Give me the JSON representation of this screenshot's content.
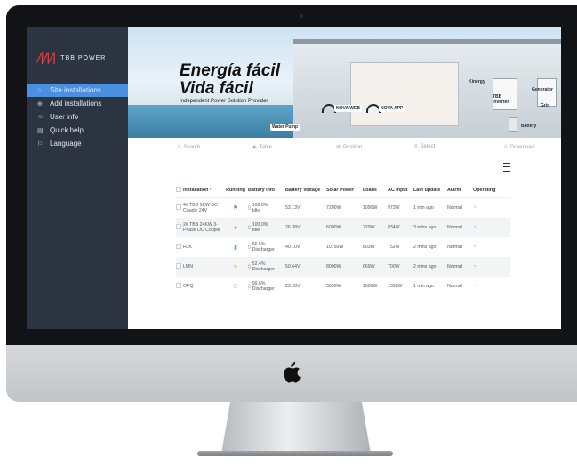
{
  "sidebar": {
    "logo_mark": "/|/|/|",
    "logo_text": "TBB POWER",
    "items": [
      {
        "label": "Site installations",
        "icon": "location-icon",
        "glyph": "⌂"
      },
      {
        "label": "Add installations",
        "icon": "plus-circle-icon",
        "glyph": "⊕"
      },
      {
        "label": "User info",
        "icon": "user-icon",
        "glyph": "☺"
      },
      {
        "label": "Quick help",
        "icon": "help-doc-icon",
        "glyph": "▤"
      },
      {
        "label": "Language",
        "icon": "flag-icon",
        "glyph": "⚐"
      }
    ]
  },
  "banner": {
    "title_line1": "Energía fácil",
    "title_line2": "Vida fácil",
    "subtitle": "Independent Power Solution Provider",
    "labels": {
      "water_pump": "Water Pump",
      "nova_web": "NOVA WEB",
      "nova_app": "NOVA APP",
      "kinergy": "Kinergy",
      "tbb_inverter": "TBB Inverter",
      "generator": "Generator",
      "grid": "Grid",
      "battery": "Battery"
    }
  },
  "toolbar": {
    "search": "Search",
    "table": "Table",
    "position": "Position",
    "select": "Select",
    "download": "Download"
  },
  "table": {
    "headers": [
      "Installation ^",
      "Running",
      "Battery Info",
      "Battery Voltage",
      "Solar Power",
      "Loads",
      "AC Input",
      "Last update",
      "Alarm",
      "Operating"
    ],
    "rows": [
      {
        "installation": "4# TBB 5KW DC Couple 24V",
        "running_icon": "tower-icon",
        "running_glyph": "⚑",
        "running_color": "#6b8fd6",
        "battery_pct": "100.0%",
        "battery_state": "Idle",
        "voltage": "52.13V",
        "solar": "7200W",
        "loads": "1090W",
        "ac_input": "973W",
        "last_update": "1 min ago",
        "alarm": "Normal",
        "operating_icon": "signal-icon"
      },
      {
        "installation": "2# TBB 24KW 3-Phase DC Couple",
        "running_icon": "water-drop-icon",
        "running_glyph": "●",
        "running_color": "#3cc0c8",
        "battery_pct": "100.0%",
        "battery_state": "Idle",
        "voltage": "26.38V",
        "solar": "6000W",
        "loads": "729W",
        "ac_input": "834W",
        "last_update": "3 mins ago",
        "alarm": "Normal",
        "operating_icon": "signal-icon"
      },
      {
        "installation": "HJK",
        "running_icon": "battery-icon",
        "running_glyph": "▮",
        "running_color": "#4cc26a",
        "battery_pct": "66.5%",
        "battery_state": "Discharger",
        "voltage": "40.10V",
        "solar": "10750W",
        "loads": "803W",
        "ac_input": "752W",
        "last_update": "2 mins ago",
        "alarm": "Normal",
        "operating_icon": "signal-icon"
      },
      {
        "installation": "LMN",
        "running_icon": "sun-icon",
        "running_glyph": "☀",
        "running_color": "#f2b632",
        "battery_pct": "52.4%",
        "battery_state": "Discharger",
        "voltage": "50.64V",
        "solar": "8000W",
        "loads": "669W",
        "ac_input": "700W",
        "last_update": "2 mins ago",
        "alarm": "Normal",
        "operating_icon": "signal-icon"
      },
      {
        "installation": "OPQ",
        "running_icon": "leaf-icon",
        "running_glyph": "∅",
        "running_color": "#bfc4ca",
        "battery_pct": "99.6%",
        "battery_state": "Discharger",
        "voltage": "23.28V",
        "solar": "5030W",
        "loads": "1500W",
        "ac_input": "1358W",
        "last_update": "1 min ago",
        "alarm": "Normal",
        "operating_icon": "signal-icon"
      }
    ]
  },
  "colors": {
    "sidebar_bg": "#2c3441",
    "active_item": "#4a90e2",
    "brand_red": "#e23c3c"
  }
}
